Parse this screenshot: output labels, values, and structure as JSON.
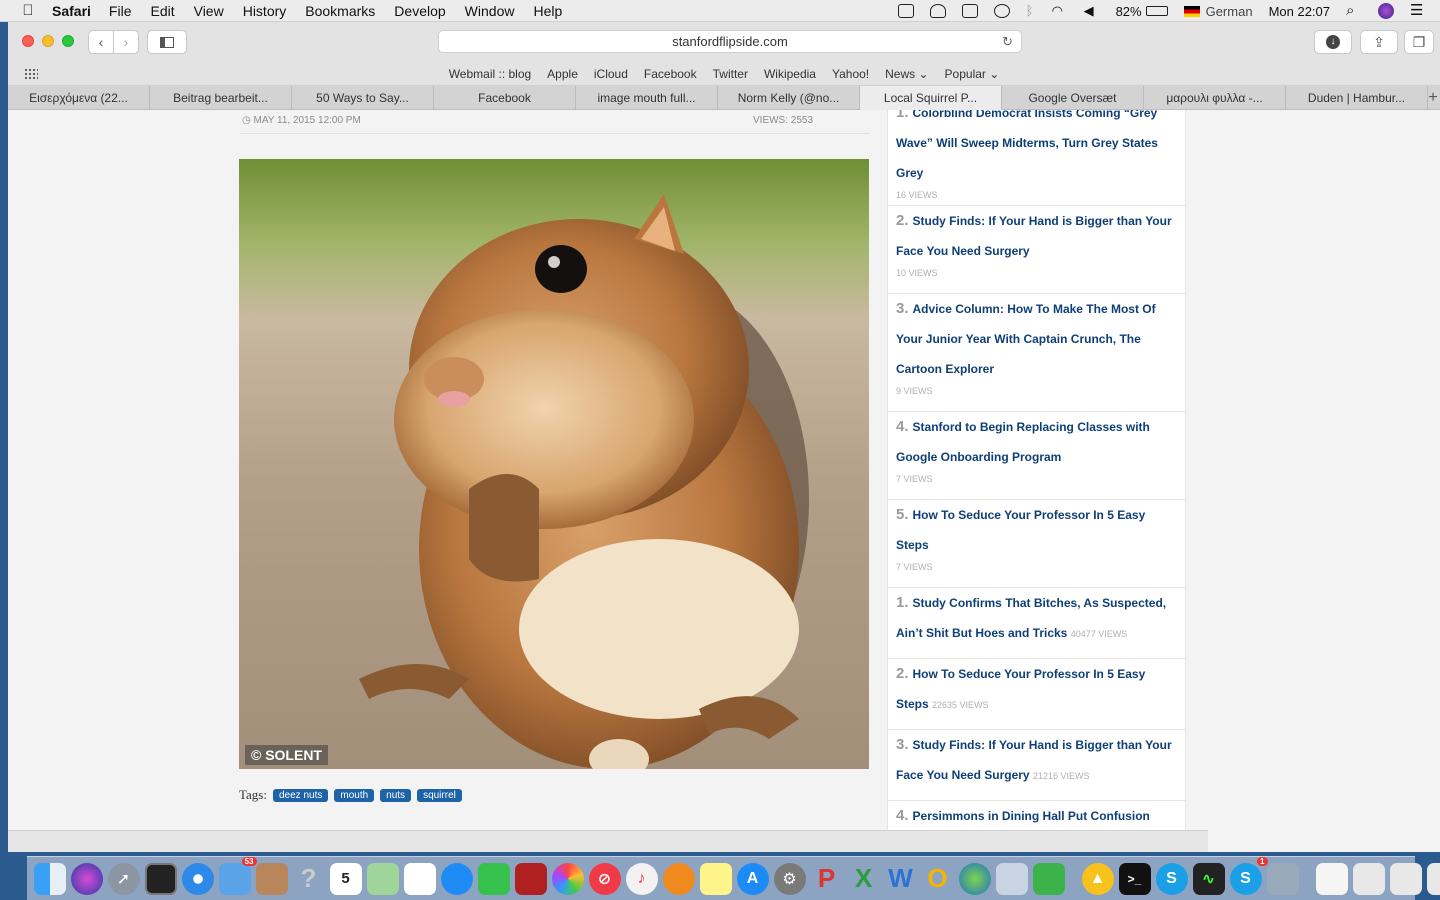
{
  "menubar": {
    "app_name": "Safari",
    "menus": [
      "File",
      "Edit",
      "View",
      "History",
      "Bookmarks",
      "Develop",
      "Window",
      "Help"
    ],
    "battery": "82%",
    "input_source": "German",
    "clock": "Mon 22:07"
  },
  "toolbar": {
    "url": "stanfordflipside.com"
  },
  "favorites": [
    "Webmail :: blog",
    "Apple",
    "iCloud",
    "Facebook",
    "Twitter",
    "Wikipedia",
    "Yahoo!",
    "News ⌄",
    "Popular ⌄"
  ],
  "tabs": [
    {
      "label": "Εισερχόμενα (22..."
    },
    {
      "label": "Beitrag bearbeit..."
    },
    {
      "label": "50 Ways to Say..."
    },
    {
      "label": "Facebook"
    },
    {
      "label": "image mouth full..."
    },
    {
      "label": "Norm Kelly (@no..."
    },
    {
      "label": "Local Squirrel P...",
      "active": true
    },
    {
      "label": "Google Oversæt"
    },
    {
      "label": "μαρουλι φυλλα -..."
    },
    {
      "label": "Duden | Hambur..."
    }
  ],
  "article": {
    "date": "MAY 11, 2015 12:00 PM",
    "views": "VIEWS: 2553",
    "photo_credit": "© SOLENT",
    "tags_label": "Tags:",
    "tags": [
      "deez nuts",
      "mouth",
      "nuts",
      "squirrel"
    ]
  },
  "sidebar": {
    "items": [
      {
        "num": "1.",
        "title": "Colorblind Democrat Insists Coming “Grey Wave” Will Sweep Midterms, Turn Grey States Grey",
        "views": "16 VIEWS"
      },
      {
        "num": "2.",
        "title": "Study Finds: If Your Hand is Bigger than Your Face You Need Surgery",
        "views": "10 VIEWS"
      },
      {
        "num": "3.",
        "title": "Advice Column: How To Make The Most Of Your Junior Year With Captain Crunch, The Cartoon Explorer",
        "views": "9 VIEWS"
      },
      {
        "num": "4.",
        "title": "Stanford to Begin Replacing Classes with Google Onboarding Program",
        "views": "7 VIEWS"
      },
      {
        "num": "5.",
        "title": "How To Seduce Your Professor In 5 Easy Steps",
        "views": "7 VIEWS"
      }
    ],
    "popular": [
      {
        "num": "1.",
        "title": "Study Confirms That Bitches, As Suspected, Ain’t Shit But Hoes and Tricks",
        "views": "40477 VIEWS"
      },
      {
        "num": "2.",
        "title": "How To Seduce Your Professor In 5 Easy Steps",
        "views": "22635 VIEWS"
      },
      {
        "num": "3.",
        "title": "Study Finds: If Your Hand is Bigger than Your Face You Need Surgery",
        "views": "21216 VIEWS"
      },
      {
        "num": "4.",
        "title": "Persimmons in Dining Hall Put Confusion",
        "views": ""
      }
    ]
  },
  "dock": {
    "icons": [
      "finder-icon",
      "siri-icon",
      "launchpad-icon",
      "mission-control-icon",
      "safari-icon",
      "mail-icon",
      "notes-icon",
      "help-icon",
      "calendar-icon",
      "maps-icon",
      "reminders-icon",
      "messages-icon",
      "facetime-icon",
      "photo-booth-icon",
      "photos-icon",
      "news-icon",
      "music-icon",
      "books-icon",
      "stickies-icon",
      "app-store-icon",
      "system-preferences-icon",
      "powerpoint-icon",
      "excel-icon",
      "word-icon",
      "outlook-icon",
      "network-icon",
      "preview-icon",
      "contacts-icon",
      "vlc-icon",
      "terminal-icon",
      "skype-icon",
      "activity-monitor-icon",
      "skype-badge-icon",
      "screenshot-icon",
      "document-icon",
      "window-icon",
      "window2-icon",
      "window3-icon",
      "trash-icon"
    ],
    "calendar_day": "5",
    "mail_badge": "53",
    "skype_badge": "1"
  }
}
